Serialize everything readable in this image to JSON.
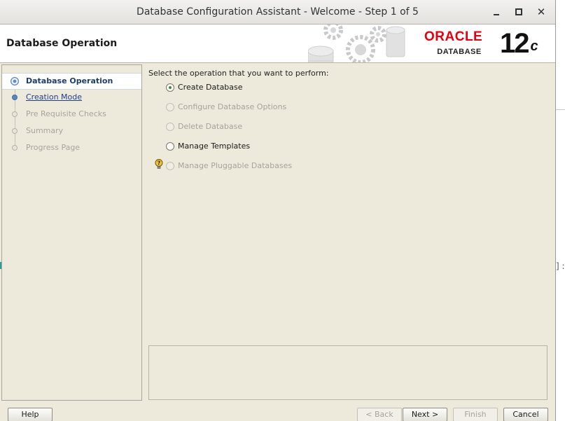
{
  "window": {
    "title": "Database Configuration Assistant - Welcome - Step 1 of 5",
    "controls": {
      "minimize": "_",
      "maximize": "□",
      "close": "✕"
    }
  },
  "banner": {
    "page_title": "Database Operation",
    "brand": "ORACLE",
    "product": "DATABASE",
    "version": "12",
    "version_suffix": "c",
    "brand_color": "#e3000f"
  },
  "steps": [
    {
      "label": "Database Operation",
      "state": "current"
    },
    {
      "label": "Creation Mode",
      "state": "link"
    },
    {
      "label": "Pre Requisite Checks",
      "state": "disabled"
    },
    {
      "label": "Summary",
      "state": "disabled"
    },
    {
      "label": "Progress Page",
      "state": "disabled"
    }
  ],
  "main": {
    "prompt": "Select the operation that you want to perform:",
    "options": [
      {
        "label": "Create Database",
        "checked": true,
        "enabled": true
      },
      {
        "label": "Configure Database Options",
        "checked": false,
        "enabled": false
      },
      {
        "label": "Delete Database",
        "checked": false,
        "enabled": false
      },
      {
        "label": "Manage Templates",
        "checked": false,
        "enabled": true
      },
      {
        "label": "Manage Pluggable Databases",
        "checked": false,
        "enabled": false,
        "icon": "hint-icon"
      }
    ]
  },
  "buttons": {
    "help": "Help",
    "back": "< Back",
    "next": "Next >",
    "finish": "Finish",
    "cancel": "Cancel"
  },
  "background_fragment": {
    "text": "] :"
  }
}
